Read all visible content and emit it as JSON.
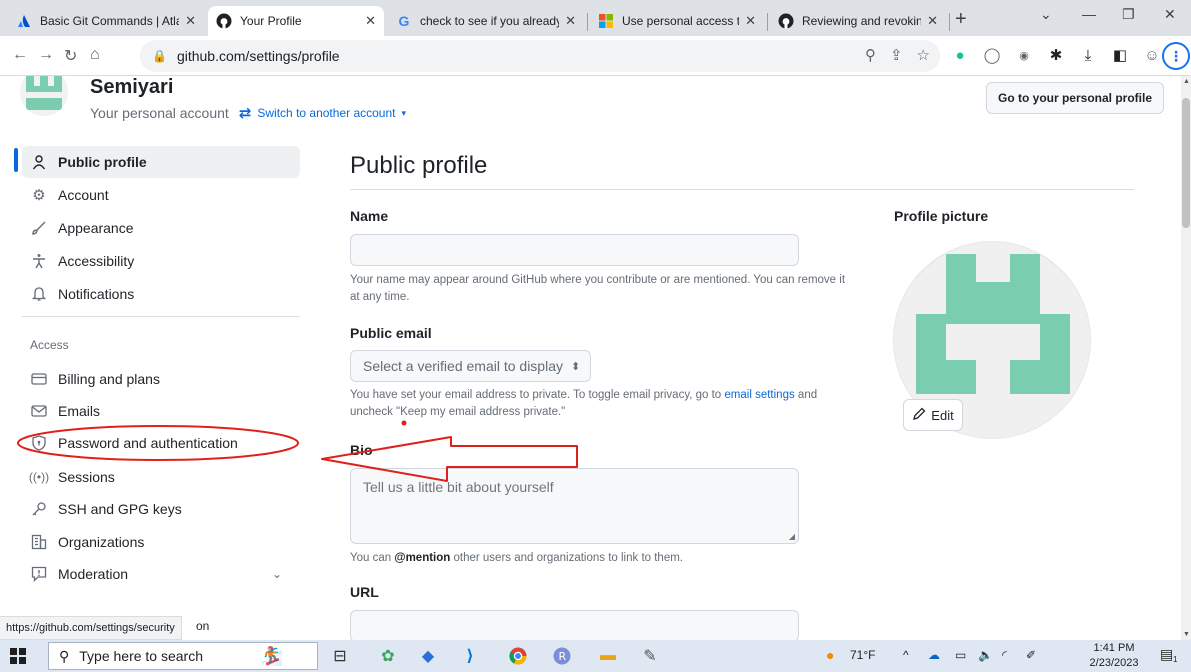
{
  "browser": {
    "tabs": [
      {
        "title": "Basic Git Commands | Atla",
        "close": "✕",
        "active": false
      },
      {
        "title": "Your Profile",
        "close": "✕",
        "active": true
      },
      {
        "title": "check to see if you already",
        "close": "✕",
        "active": false
      },
      {
        "title": "Use personal access token",
        "close": "✕",
        "active": false
      },
      {
        "title": "Reviewing and revoking p",
        "close": "✕",
        "active": false
      }
    ],
    "new_tab": "+",
    "url": "github.com/settings/profile"
  },
  "account": {
    "name": "Semiyari",
    "subtitle": "Your personal account",
    "switch_label": "Switch to another account",
    "profile_button": "Go to your personal profile"
  },
  "sidebar": {
    "items": [
      {
        "label": "Public profile",
        "icon": "person-icon"
      },
      {
        "label": "Account",
        "icon": "gear-icon"
      },
      {
        "label": "Appearance",
        "icon": "paintbrush-icon"
      },
      {
        "label": "Accessibility",
        "icon": "accessibility-icon"
      },
      {
        "label": "Notifications",
        "icon": "bell-icon"
      }
    ],
    "access_heading": "Access",
    "access_items": [
      {
        "label": "Billing and plans",
        "icon": "credit-card-icon"
      },
      {
        "label": "Emails",
        "icon": "mail-icon"
      },
      {
        "label": "Password and authentication",
        "icon": "shield-lock-icon"
      },
      {
        "label": "Sessions",
        "icon": "broadcast-icon"
      },
      {
        "label": "SSH and GPG keys",
        "icon": "key-icon"
      },
      {
        "label": "Organizations",
        "icon": "organization-icon"
      },
      {
        "label": "Moderation",
        "icon": "report-icon"
      }
    ],
    "partial_item": "on"
  },
  "main": {
    "title": "Public profile",
    "name_label": "Name",
    "name_value": "",
    "name_note": "Your name may appear around GitHub where you contribute or are mentioned. You can remove it at any time.",
    "email_label": "Public email",
    "email_select": "Select a verified email to display",
    "email_note_1": "You have set your email address to private. To toggle email privacy, go to",
    "email_note_link": "email settings",
    "email_note_2": "and uncheck \"Keep my email address private.\"",
    "bio_label": "Bio",
    "bio_placeholder": "Tell us a little bit about yourself",
    "bio_note_1": "You can",
    "bio_note_bold": "@mention",
    "bio_note_2": "other users and organizations to link to them.",
    "url_label": "URL",
    "profile_picture_label": "Profile picture",
    "edit_label": "Edit"
  },
  "status_url": "https://github.com/settings/security",
  "taskbar": {
    "search_placeholder": "Type here to search",
    "weather": "71°F",
    "time": "1:41 PM",
    "date": "2/23/2023",
    "notification_count": "1"
  },
  "colors": {
    "accent": "#0969da",
    "avatar_green": "#7bcdb0",
    "annotation_red": "#e0201b"
  }
}
